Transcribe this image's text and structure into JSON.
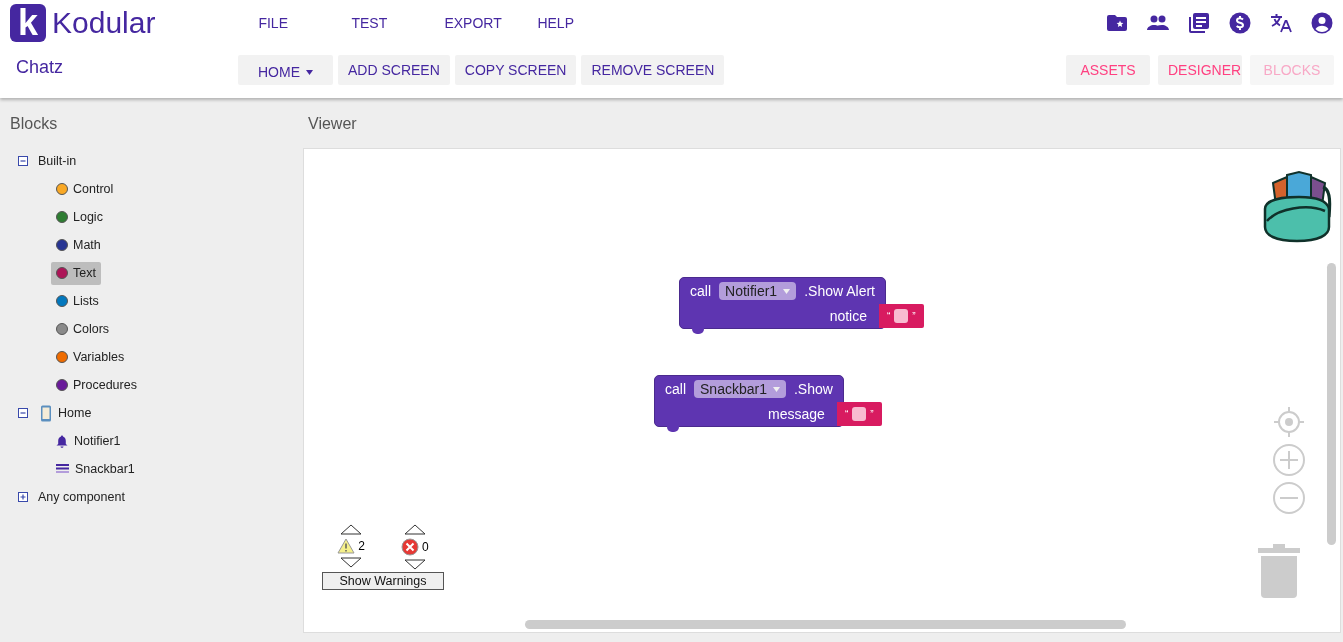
{
  "app": {
    "logo_letter": "k",
    "name": "Kodular"
  },
  "menu": [
    "FILE",
    "TEST",
    "EXPORT",
    "HELP"
  ],
  "project": "Chatz",
  "screen_buttons": [
    {
      "label": "HOME",
      "kind": "dropdown"
    },
    {
      "label": "ADD SCREEN",
      "kind": "plain"
    },
    {
      "label": "COPY SCREEN",
      "kind": "plain"
    },
    {
      "label": "REMOVE SCREEN",
      "kind": "plain"
    }
  ],
  "view_buttons": [
    {
      "label": "ASSETS",
      "disabled": false
    },
    {
      "label": "DESIGNER",
      "disabled": false
    },
    {
      "label": "BLOCKS",
      "disabled": true
    }
  ],
  "blocks_panel": {
    "title": "Blocks",
    "tree": [
      {
        "label": "Built-in",
        "kind": "folder",
        "expanded": true,
        "selected": false,
        "children": [
          {
            "label": "Control",
            "kind": "category",
            "color": "#f9a825",
            "selected": false
          },
          {
            "label": "Logic",
            "kind": "category",
            "color": "#2e7d32",
            "selected": false
          },
          {
            "label": "Math",
            "kind": "category",
            "color": "#283593",
            "selected": false
          },
          {
            "label": "Text",
            "kind": "category",
            "color": "#ad1457",
            "selected": true
          },
          {
            "label": "Lists",
            "kind": "category",
            "color": "#0277bd",
            "selected": false
          },
          {
            "label": "Colors",
            "kind": "category",
            "color": "#8a8a8a",
            "selected": false
          },
          {
            "label": "Variables",
            "kind": "category",
            "color": "#ef6c00",
            "selected": false
          },
          {
            "label": "Procedures",
            "kind": "category",
            "color": "#6a1b9a",
            "selected": false
          }
        ]
      },
      {
        "label": "Home",
        "kind": "screen",
        "expanded": true,
        "selected": false,
        "children": [
          {
            "label": "Notifier1",
            "kind": "notifier",
            "selected": false
          },
          {
            "label": "Snackbar1",
            "kind": "snackbar",
            "selected": false
          }
        ]
      },
      {
        "label": "Any component",
        "kind": "folder",
        "expanded": false,
        "selected": false
      }
    ]
  },
  "viewer": {
    "title": "Viewer",
    "blocks": [
      {
        "keyword": "call",
        "component": "Notifier1",
        "method": ".Show Alert",
        "parameter": "notice",
        "quote_open": "“",
        "quote_close": "”"
      },
      {
        "keyword": "call",
        "component": "Snackbar1",
        "method": ".Show",
        "parameter": "message",
        "quote_open": "“",
        "quote_close": "”"
      }
    ],
    "warnings": {
      "warning_count": "2",
      "error_count": "0",
      "button": "Show Warnings"
    }
  }
}
